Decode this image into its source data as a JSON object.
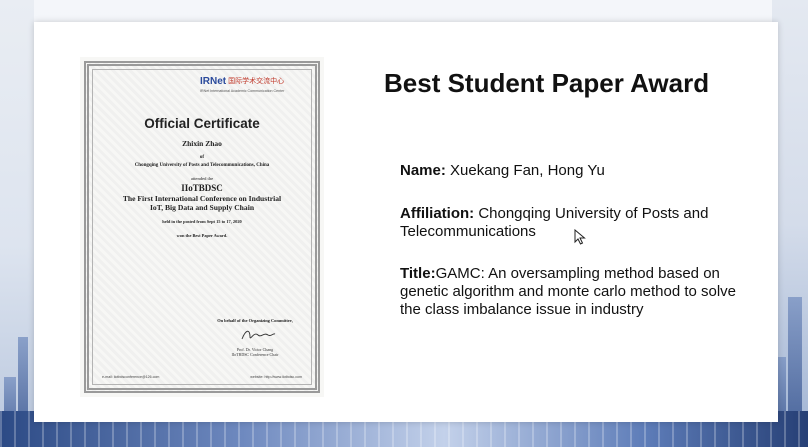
{
  "slide": {
    "title": "Best Student Paper Award",
    "name_label": "Name:",
    "name_value": " Xuekang Fan, Hong Yu",
    "affiliation_label": "Affiliation:",
    "affiliation_value": " Chongqing University of Posts and Telecommunications",
    "paper_title_label": "Title:",
    "paper_title_value": "GAMC: An oversampling method based on genetic algorithm and monte carlo method to solve the class imbalance issue in industry"
  },
  "certificate": {
    "logo_text": "IRNet",
    "logo_cn": "国际学术交流中心",
    "logo_sub": "IRNet International Academic Communication Center",
    "heading": "Official Certificate",
    "recipient": "Zhixin Zhao",
    "of_text": "of",
    "affiliation": "Chongqing University of Posts and Telecommunications, China",
    "attended": "attended the",
    "conference_abbr": "IIoTBDSC",
    "conference_line1": "The First International Conference on Industrial",
    "conference_line2": "IoT, Big Data and Supply Chain",
    "held": "held in the posted from Sept 15 to 17, 2020",
    "won": "won the Best Paper Award.",
    "behalf": "On behalf of the Organizing Committee,",
    "signer": "Prof. Dr. Victor Chang",
    "signer_role": "IIoTBDSC Conference Chair",
    "email": "e-mail: iiotbdsconference@126.com",
    "website": "website: http://www.iiotbdsc.com"
  }
}
